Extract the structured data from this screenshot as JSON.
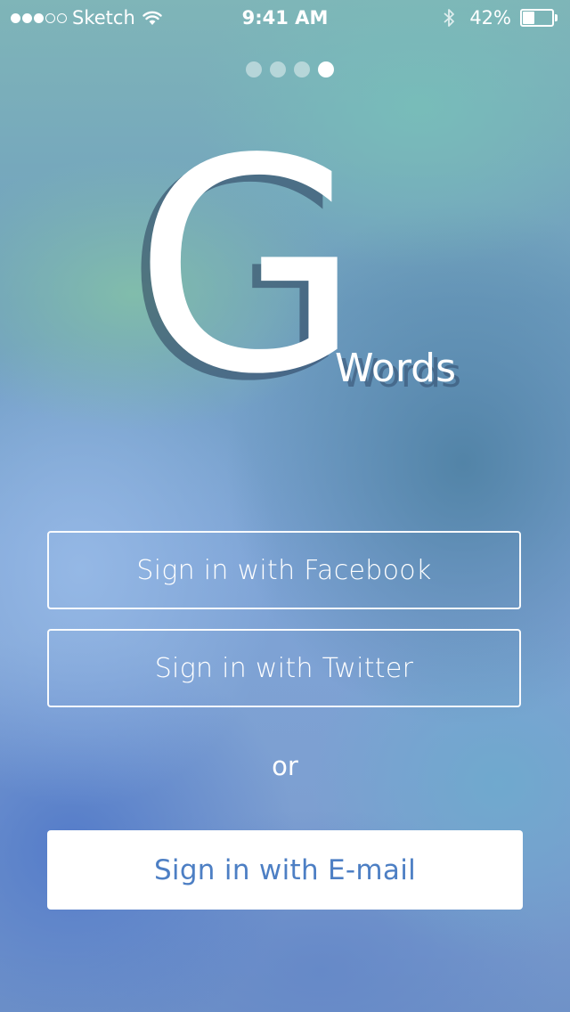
{
  "status_bar": {
    "signal_filled": 3,
    "signal_total": 5,
    "carrier": "Sketch",
    "time": "9:41 AM",
    "battery_percent_label": "42%",
    "battery_level": 0.42
  },
  "pager": {
    "count": 4,
    "active_index": 3
  },
  "logo": {
    "letter": "G",
    "word": "Words"
  },
  "buttons": {
    "facebook_label": "Sign in with Facebook",
    "twitter_label": "Sign in with Twitter",
    "separator": "or",
    "email_label": "Sign in with E-mail"
  },
  "colors": {
    "email_text": "#4d7fc4",
    "button_border": "#ffffff"
  }
}
